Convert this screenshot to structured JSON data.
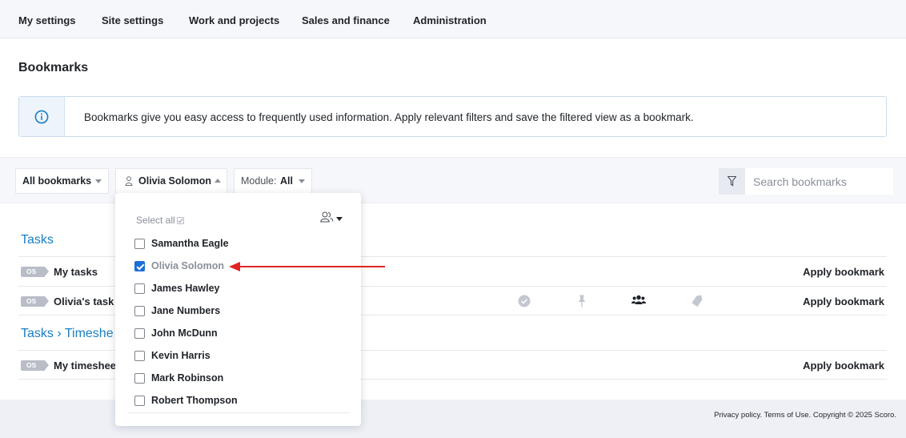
{
  "topnav": {
    "items": [
      "My settings",
      "Site settings",
      "Work and projects",
      "Sales and finance",
      "Administration"
    ]
  },
  "page": {
    "title": "Bookmarks",
    "info_text": "Bookmarks give you easy access to frequently used information. Apply relevant filters and save the filtered view as a bookmark.",
    "info_icon": "info-circle-icon"
  },
  "filters": {
    "bookmarks_filter": "All bookmarks",
    "user_filter": "Olivia Solomon",
    "module_label": "Module:",
    "module_value": "All",
    "search_placeholder": "Search bookmarks"
  },
  "sections": [
    {
      "title": "Tasks",
      "rows": [
        {
          "badge": "OS",
          "name": "My tasks",
          "action": "Apply bookmark"
        },
        {
          "badge": "OS",
          "name": "Olivia's task b",
          "action": "Apply bookmark",
          "icons": [
            "check-circle-icon",
            "pin-icon",
            "group-icon",
            "tag-icon"
          ]
        }
      ]
    },
    {
      "title": "Tasks › Timeshe",
      "rows": [
        {
          "badge": "OS",
          "name": "My timesheet",
          "action": "Apply bookmark"
        }
      ]
    }
  ],
  "dropdown": {
    "select_all_label": "Select all",
    "options": [
      {
        "label": "Samantha Eagle",
        "checked": false
      },
      {
        "label": "Olivia Solomon",
        "checked": true
      },
      {
        "label": "James Hawley",
        "checked": false
      },
      {
        "label": "Jane Numbers",
        "checked": false
      },
      {
        "label": "John McDunn",
        "checked": false
      },
      {
        "label": "Kevin Harris",
        "checked": false
      },
      {
        "label": "Mark Robinson",
        "checked": false
      },
      {
        "label": "Robert Thompson",
        "checked": false
      }
    ]
  },
  "footer": {
    "text": "Privacy policy. Terms of Use. Copyright © 2025 Scoro."
  },
  "colors": {
    "accent": "#1a7ec2",
    "checkbox": "#1c6fd6",
    "annotation_arrow": "#e02424"
  }
}
